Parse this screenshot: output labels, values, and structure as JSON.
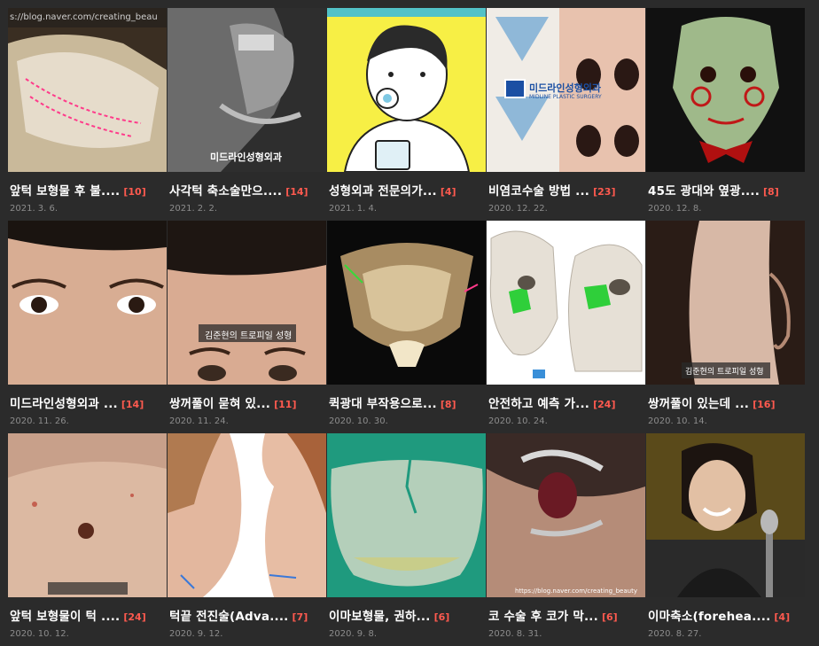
{
  "posts": [
    {
      "title": "앞턱 보형물 후 불....",
      "count": "[10]",
      "date": "2021. 3. 6.",
      "thumb": "jaw-ct-scan",
      "overlay": "s://blog.naver.com/creating_beau"
    },
    {
      "title": "사각턱 축소술만으....",
      "count": "[14]",
      "date": "2021. 2. 2.",
      "thumb": "jaw-xray",
      "overlay": "미드라인성형외과"
    },
    {
      "title": "성형외과 전문의가...",
      "count": "[4]",
      "date": "2021. 1. 4.",
      "thumb": "cartoon-boy",
      "overlay": ""
    },
    {
      "title": "비염코수술 방법 ...",
      "count": "[23]",
      "date": "2020. 12. 22.",
      "thumb": "nose-diagram",
      "overlay": "미드라인성형외과",
      "overlay2": "MIDLINE PLASTIC SURGERY"
    },
    {
      "title": "45도 광대와 옆광....",
      "count": "[8]",
      "date": "2020. 12. 8.",
      "thumb": "puppet-mask",
      "overlay": ""
    },
    {
      "title": "미드라인성형외과 ...",
      "count": "[14]",
      "date": "2020. 11. 26.",
      "thumb": "eyes-closeup",
      "overlay": ""
    },
    {
      "title": "쌍꺼풀이 묻혀 있...",
      "count": "[11]",
      "date": "2020. 11. 24.",
      "thumb": "forehead-hairline",
      "overlay": "김준현의 트로피일 성형"
    },
    {
      "title": "퀵광대 부작용으로...",
      "count": "[8]",
      "date": "2020. 10. 30.",
      "thumb": "skull-ct",
      "overlay": ""
    },
    {
      "title": "안전하고 예측 가...",
      "count": "[24]",
      "date": "2020. 10. 24.",
      "thumb": "skull-diagram",
      "overlay": ""
    },
    {
      "title": "쌍꺼풀이 있는데 ...",
      "count": "[16]",
      "date": "2020. 10. 14.",
      "thumb": "ear-hair",
      "overlay": "김준현의 트로피일 성형"
    },
    {
      "title": "앞턱 보형물이 턱 ....",
      "count": "[24]",
      "date": "2020. 10. 12.",
      "thumb": "chin-closeup",
      "overlay": ""
    },
    {
      "title": "턱끝 전진술(Adva....",
      "count": "[7]",
      "date": "2020. 9. 12.",
      "thumb": "profile-compare",
      "overlay": ""
    },
    {
      "title": "이마보형물, 권하...",
      "count": "[6]",
      "date": "2020. 9. 8.",
      "thumb": "implant-green",
      "overlay": ""
    },
    {
      "title": "코 수술 후 코가 막...",
      "count": "[6]",
      "date": "2020. 8. 31.",
      "thumb": "nostril-speculum",
      "overlay": "https://blog.naver.com/creating_beauty"
    },
    {
      "title": "이마축소(forehea....",
      "count": "[4]",
      "date": "2020. 8. 27.",
      "thumb": "woman-mic",
      "overlay": ""
    }
  ],
  "colors": {
    "background": "#2b2b2b",
    "title": "#ffffff",
    "count": "#ff5a4f",
    "date": "#8c8c8c"
  }
}
